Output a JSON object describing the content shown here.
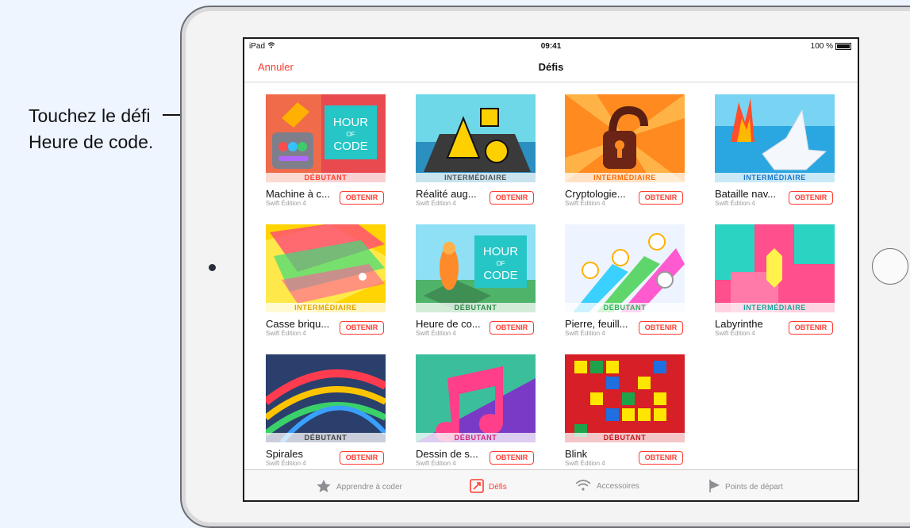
{
  "callout": {
    "line1": "Touchez le défi",
    "line2": "Heure de code."
  },
  "status": {
    "carrier": "iPad",
    "time": "09:41",
    "battery": "100 %"
  },
  "nav": {
    "cancel": "Annuler",
    "title": "Défis"
  },
  "get_label": "OBTENIR",
  "challenges": [
    {
      "title": "Machine à c...",
      "edition": "Swift Édition 4",
      "level": "DÉBUTANT",
      "level_color": "#ff3b30",
      "art": "HOUR OF CODE"
    },
    {
      "title": "Réalité aug...",
      "edition": "Swift Édition 4",
      "level": "INTERMÉDIAIRE",
      "level_color": "#555555"
    },
    {
      "title": "Cryptologie...",
      "edition": "Swift Édition 4",
      "level": "INTERMÉDIAIRE",
      "level_color": "#ff6a00"
    },
    {
      "title": "Bataille nav...",
      "edition": "Swift Édition 4",
      "level": "INTERMÉDIAIRE",
      "level_color": "#1a74c7"
    },
    {
      "title": "Casse briqu...",
      "edition": "Swift Édition 4",
      "level": "INTERMÉDIAIRE",
      "level_color": "#e0a400"
    },
    {
      "title": "Heure de co...",
      "edition": "Swift Édition 4",
      "level": "DÉBUTANT",
      "level_color": "#2d8a4a",
      "art": "HOUR OF CODE"
    },
    {
      "title": "Pierre, feuill...",
      "edition": "Swift Édition 4",
      "level": "DÉBUTANT",
      "level_color": "#2fb15a"
    },
    {
      "title": "Labyrinthe",
      "edition": "Swift Édition 4",
      "level": "INTERMÉDIAIRE",
      "level_color": "#1aa39a"
    },
    {
      "title": "Spirales",
      "edition": "Swift Édition 4",
      "level": "DÉBUTANT",
      "level_color": "#444444"
    },
    {
      "title": "Dessin de s...",
      "edition": "Swift Édition 4",
      "level": "DÉBUTANT",
      "level_color": "#d6267a"
    },
    {
      "title": "Blink",
      "edition": "Swift Édition 4",
      "level": "DÉBUTANT",
      "level_color": "#c4161c"
    }
  ],
  "tabs": [
    {
      "label": "Apprendre à coder",
      "icon": "star-icon"
    },
    {
      "label": "Défis",
      "icon": "challenge-icon",
      "active": true
    },
    {
      "label": "Accessoires",
      "icon": "wifi-icon"
    },
    {
      "label": "Points de départ",
      "icon": "flag-icon"
    }
  ]
}
